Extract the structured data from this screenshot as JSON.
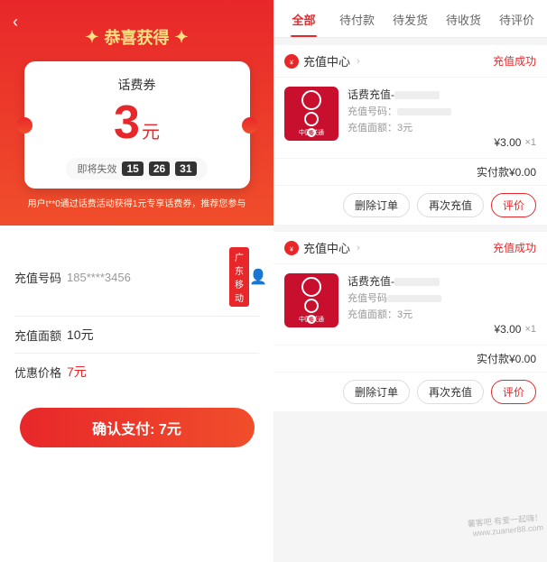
{
  "left": {
    "back_label": "‹",
    "congrats_text": "恭喜获得",
    "sparkle_left": "✦",
    "sparkle_right": "✦",
    "coupon": {
      "title": "话费券",
      "amount": "3",
      "unit": "元",
      "expire_label": "即将失效",
      "time1": "15",
      "time2": "26",
      "time3": "31"
    },
    "promo_text": "用户t**0通过话费活动获得1元专享话费券，推荐您参与",
    "form": {
      "phone_label": "充值号码",
      "phone_value": "185****3456",
      "carrier_tag": "广东移动",
      "amount_label": "充值面额",
      "amount_value": "10元",
      "price_label": "优惠价格",
      "price_value": "7元"
    },
    "confirm_btn": "确认支付: 7元"
  },
  "right": {
    "tabs": [
      {
        "label": "全部",
        "active": true
      },
      {
        "label": "待付款",
        "active": false
      },
      {
        "label": "待发货",
        "active": false
      },
      {
        "label": "待收货",
        "active": false
      },
      {
        "label": "待评价",
        "active": false
      }
    ],
    "orders": [
      {
        "store": "充值中心",
        "status": "充值成功",
        "product_name": "话费充值-",
        "detail1": "充值号码：",
        "detail2": "充值面额：3元",
        "price": "¥3.00",
        "qty": "×1",
        "actual_label": "实付款¥0.00",
        "btn1": "删除订单",
        "btn2": "再次充值",
        "btn3": "评价"
      },
      {
        "store": "充值中心",
        "status": "充值成功",
        "product_name": "话费充值-",
        "detail1": "充值号码",
        "detail2": "充值面额：3元",
        "price": "¥3.00",
        "qty": "×1",
        "actual_label": "实付款¥0.00",
        "btn1": "删除订单",
        "btn2": "再次充值",
        "btn3": "评价"
      }
    ],
    "watermark": "薯客吧 有爱一起嗨！\nwww.zuaner88.com"
  }
}
